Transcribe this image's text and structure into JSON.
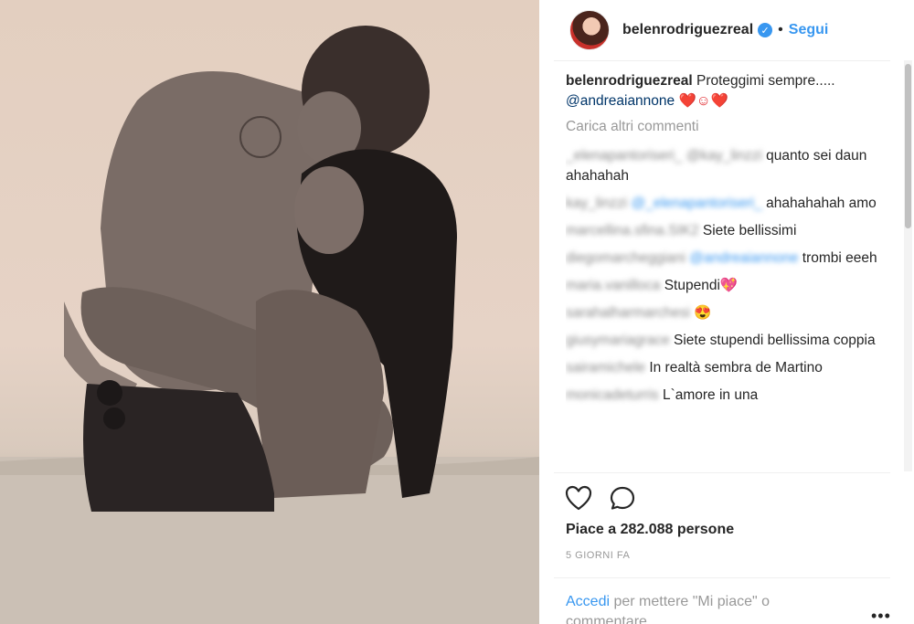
{
  "post": {
    "username": "belenrodriguezreal",
    "verified_glyph": "✓",
    "dot": "•",
    "follow_label": "Segui",
    "caption_text": "Proteggimi sempre..... ",
    "caption_mention": "@andreaiannone",
    "caption_emoji": "❤️☺❤️"
  },
  "comments": {
    "load_more": "Carica altri commenti",
    "items": [
      {
        "user": "_elenapantoriseri_ @kay_linzzi",
        "text": " quanto sei daun ahahahah"
      },
      {
        "user": "kay_linzzi",
        "mention": "@_elenapantoriseri_",
        "text": " ahahahahah amo"
      },
      {
        "user": "marcellina.sfina.SIK2",
        "text": " Siete bellissimi"
      },
      {
        "user": "diegomarcheggiani",
        "mention": "@andreaiannone",
        "text": " trombi eeeh"
      },
      {
        "user": "maria.vanilloca",
        "text": " Stupendi💖"
      },
      {
        "user": "sarahalharmarchesi",
        "text": " 😍"
      },
      {
        "user": "giusymariagrace",
        "text": " Siete stupendi bellissima coppia"
      },
      {
        "user": "sairamichele",
        "text": " In realtà sembra de Martino"
      },
      {
        "user": "monicadeturris",
        "text": " L`amore in una"
      }
    ]
  },
  "footer": {
    "likes": "Piace a 282.088 persone",
    "time": "5 GIORNI FA",
    "login_link": "Accedi",
    "login_text": " per mettere \"Mi piace\" o commentare",
    "more_label": "•••"
  },
  "icons": {
    "like": "heart-outline-icon",
    "comment": "speech-bubble-icon"
  },
  "colors": {
    "accent": "#3897f0",
    "mention": "#003569",
    "muted": "#999999"
  }
}
